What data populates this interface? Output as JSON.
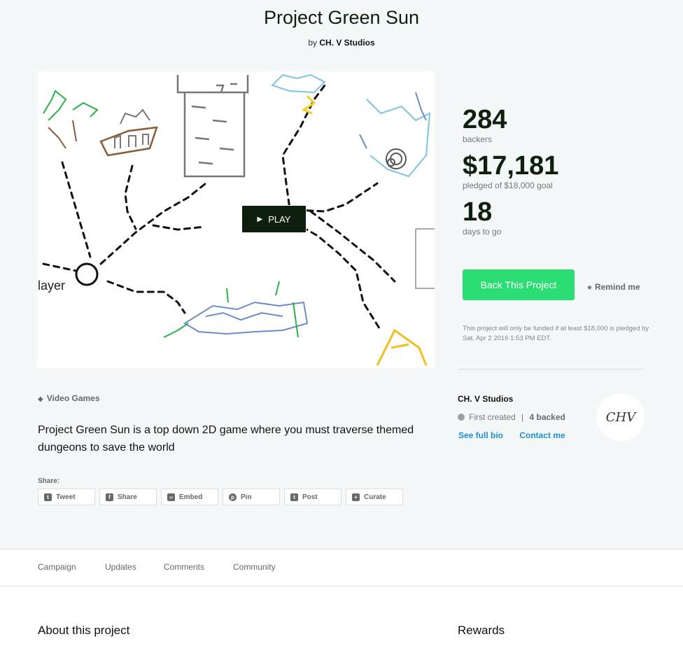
{
  "project": {
    "title": "Project Green Sun",
    "by_prefix": "by",
    "creator": "CH. V Studios"
  },
  "video": {
    "play_label": "PLAY",
    "play_icon": "play-triangle-icon",
    "caption_fragment": "layer"
  },
  "stats": {
    "backers_count": "284",
    "backers_label": "backers",
    "pledged_amount": "$17,181",
    "pledged_label": "pledged of $18,000 goal",
    "days_count": "18",
    "days_label": "days to go"
  },
  "actions": {
    "back_label": "Back This Project",
    "remind_label": "Remind me",
    "fund_note": "This project will only be funded if at least $18,000 is pledged by Sat, Apr 2 2016 1:53 PM EDT."
  },
  "creator_box": {
    "name": "CH. V Studios",
    "first_created": "First created",
    "separator": "|",
    "backed": "4 backed",
    "see_bio": "See full bio",
    "contact": "Contact me",
    "avatar_text": "CHV"
  },
  "category": "Video Games",
  "blurb": "Project Green Sun is a top down 2D game where you must traverse themed dungeons to save the world",
  "share": {
    "label": "Share:",
    "buttons": [
      {
        "label": "Tweet",
        "icon": "twitter-icon"
      },
      {
        "label": "Share",
        "icon": "facebook-icon"
      },
      {
        "label": "Embed",
        "icon": "embed-icon"
      },
      {
        "label": "Pin",
        "icon": "pinterest-icon"
      },
      {
        "label": "Post",
        "icon": "tumblr-icon"
      },
      {
        "label": "Curate",
        "icon": "plus-icon"
      }
    ]
  },
  "tabs": [
    "Campaign",
    "Updates",
    "Comments",
    "Community"
  ],
  "sections": {
    "about": "About this project",
    "rewards": "Rewards"
  },
  "colors": {
    "accent_green": "#2bde73",
    "dark_green": "#0e1f0e",
    "link_blue": "#1a8fd8",
    "hero_bg": "#f5f8f8"
  }
}
